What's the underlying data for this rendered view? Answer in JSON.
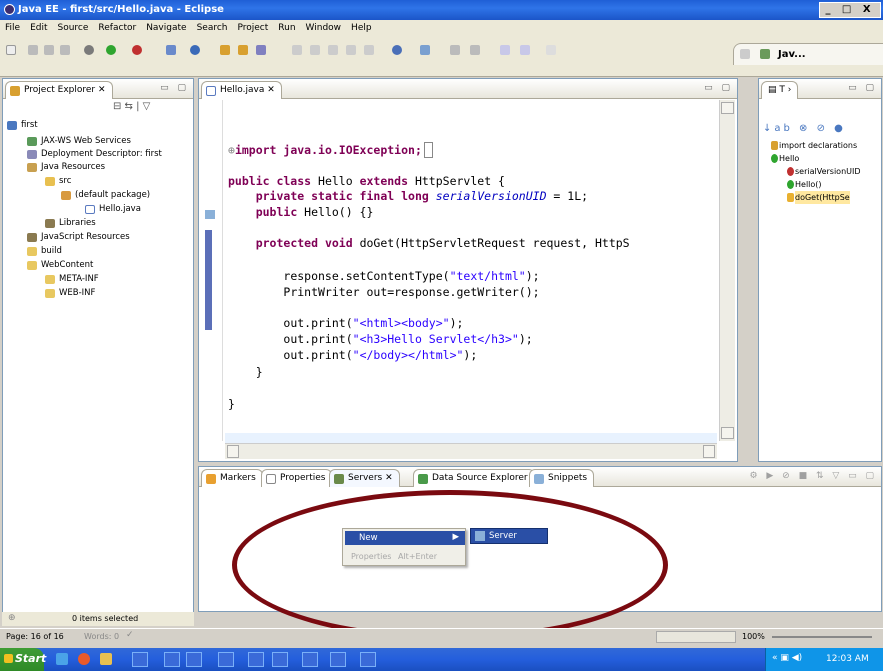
{
  "window": {
    "title": "Java EE - first/src/Hello.java - Eclipse",
    "controls": "_ □ X"
  },
  "menu": [
    "File",
    "Edit",
    "Source",
    "Refactor",
    "Navigate",
    "Search",
    "Project",
    "Run",
    "Window",
    "Help"
  ],
  "perspective": {
    "label": "Jav..."
  },
  "project_explorer": {
    "tab_label": "Project Explorer",
    "items": [
      {
        "label": "first",
        "icon": "project-icon"
      },
      {
        "label": "JAX-WS Web Services",
        "icon": "webservice-icon"
      },
      {
        "label": "Deployment Descriptor: first",
        "icon": "descriptor-icon"
      },
      {
        "label": "Java Resources",
        "icon": "java-resources-icon"
      },
      {
        "label": "src",
        "icon": "src-folder-icon"
      },
      {
        "label": "(default package)",
        "icon": "package-icon"
      },
      {
        "label": "Hello.java",
        "icon": "java-file-icon"
      },
      {
        "label": "Libraries",
        "icon": "libraries-icon"
      },
      {
        "label": "JavaScript Resources",
        "icon": "js-resources-icon"
      },
      {
        "label": "build",
        "icon": "folder-icon"
      },
      {
        "label": "WebContent",
        "icon": "folder-icon"
      },
      {
        "label": "META-INF",
        "icon": "folder-icon"
      },
      {
        "label": "WEB-INF",
        "icon": "folder-icon"
      }
    ]
  },
  "editor": {
    "tab_label": "Hello.java",
    "lines": {
      "l1": "import java.io.IOException;",
      "l2_kw1": "public class",
      "l2_a": " Hello ",
      "l2_kw2": "extends",
      "l2_b": " HttpServlet {",
      "l3_kw": "private static final long ",
      "l3_field": "serialVersionUID",
      "l3_rest": " = 1L;",
      "l4_kw": "public",
      "l4_rest": " Hello() {}",
      "l5_kw": "protected void",
      "l5_rest": " doGet(HttpServletRequest request, HttpS",
      "l6_a": "response.setContentType(",
      "l6_s": "\"text/html\"",
      "l6_b": ");",
      "l7": "PrintWriter out=response.getWriter();",
      "l8_a": "out.print(",
      "l8_s": "\"<html><body>\"",
      "l8_b": ");",
      "l9_a": "out.print(",
      "l9_s": "\"<h3>Hello Servlet</h3>\"",
      "l9_b": ");",
      "l10_a": "out.print(",
      "l10_s": "\"</body></html>\"",
      "l10_b": ");",
      "l11": "}",
      "l12": "}"
    }
  },
  "outline": {
    "items": [
      {
        "label": "import declarations"
      },
      {
        "label": "Hello"
      },
      {
        "label": "serialVersionUID"
      },
      {
        "label": "Hello()"
      },
      {
        "label": "doGet(HttpSe"
      }
    ]
  },
  "bottom_tabs": [
    "Markers",
    "Properties",
    "Servers",
    "Data Source Explorer",
    "Snippets"
  ],
  "context_menu": {
    "new_label": "New",
    "props_label": "Properties",
    "props_shortcut": "Alt+Enter",
    "submenu_label": "Server"
  },
  "status": {
    "selected": "0 items selected",
    "page": "Page: 16 of 16",
    "words": "Words: 0",
    "zoom": "100%"
  },
  "taskbar": {
    "start": "Start",
    "time": "12:03 AM"
  },
  "colors": {
    "annotation_ellipse": "#7a0a10",
    "menu_highlight": "#2a4fa6"
  }
}
